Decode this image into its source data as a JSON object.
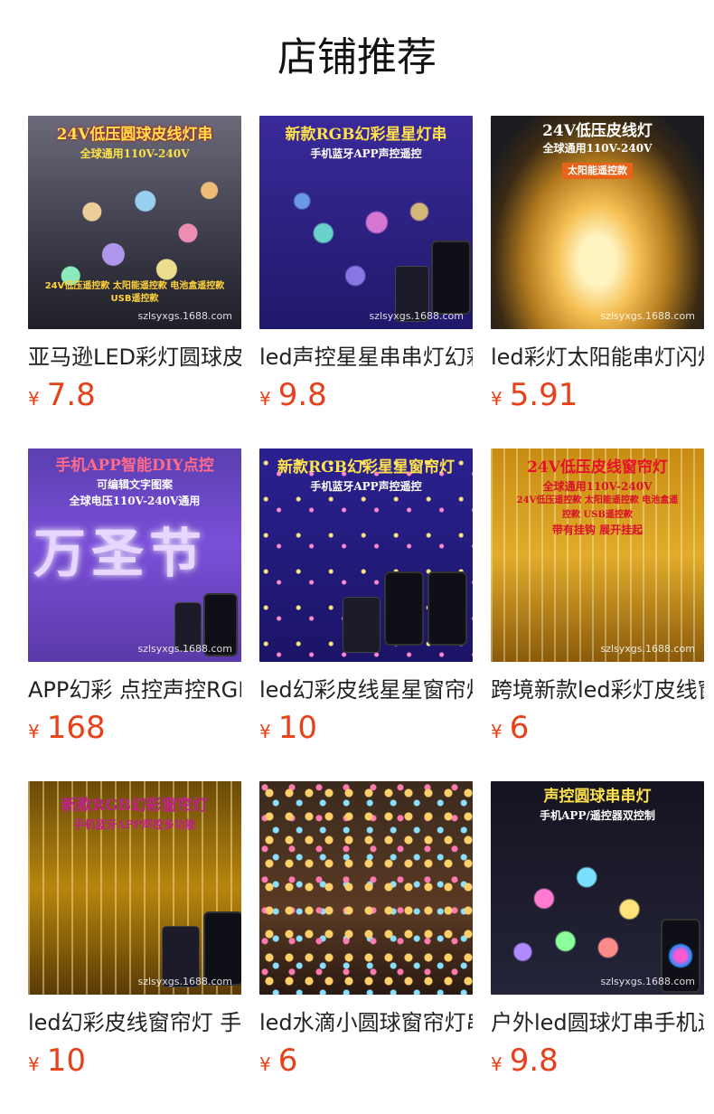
{
  "page": {
    "title": "店铺推荐"
  },
  "products": [
    {
      "name": "亚马逊LED彩灯圆球皮线灯串",
      "price": "7.8",
      "currency": "¥",
      "image": {
        "caption": "24V低压圆球皮线灯串",
        "subcaption": "全球通用110V-240V",
        "footer": "24V低压遥控款 太阳能遥控款 电池盒遥控款 USB遥控款",
        "watermark": "szlsyxgs.1688.com"
      }
    },
    {
      "name": "led声控星星串串灯幻彩",
      "price": "9.8",
      "currency": "¥",
      "image": {
        "caption": "新款RGB幻彩星星灯串",
        "subcaption": "手机蓝牙APP声控遥控",
        "watermark": "szlsyxgs.1688.com"
      }
    },
    {
      "name": "led彩灯太阳能串灯闪灯",
      "price": "5.91",
      "currency": "¥",
      "image": {
        "caption": "24V低压皮线灯",
        "subcaption": "全球通用110V-240V",
        "badge": "太阳能遥控款",
        "watermark": "szlsyxgs.1688.com"
      }
    },
    {
      "name": "APP幻彩 点控声控RGB",
      "price": "168",
      "currency": "¥",
      "image": {
        "caption": "手机APP智能DIY点控",
        "subcaption": "可编辑文字图案",
        "subcaption2": "全球电压110V-240V通用",
        "bigtext": "万圣节",
        "watermark": "szlsyxgs.1688.com"
      }
    },
    {
      "name": "led幻彩皮线星星窗帘灯",
      "price": "10",
      "currency": "¥",
      "image": {
        "caption": "新款RGB幻彩星星窗帘灯",
        "subcaption": "手机蓝牙APP声控遥控"
      }
    },
    {
      "name": "跨境新款led彩灯皮线窗帘",
      "price": "6",
      "currency": "¥",
      "image": {
        "caption": "24V低压皮线窗帘灯",
        "subcaption": "全球通用110V-240V",
        "subcaption2": "24V低压遥控款 太阳能遥控款 电池盒遥控款 USB遥控款",
        "subcaption3": "带有挂钩 展开挂起",
        "watermark": "szlsyxgs.1688.com"
      }
    },
    {
      "name": "led幻彩皮线窗帘灯 手机",
      "price": "10",
      "currency": "¥",
      "image": {
        "caption": "新款RGB幻彩窗帘灯",
        "subcaption": "手机蓝牙APP声控多功能",
        "watermark": "szlsyxgs.1688.com"
      }
    },
    {
      "name": "led水滴小圆球窗帘灯串",
      "price": "6",
      "currency": "¥",
      "image": {}
    },
    {
      "name": "户外led圆球灯串手机遥控",
      "price": "9.8",
      "currency": "¥",
      "image": {
        "caption": "声控圆球串串灯",
        "subcaption": "手机APP/遥控器双控制",
        "watermark": "szlsyxgs.1688.com"
      }
    }
  ],
  "colors": {
    "price": "#e8401a",
    "text": "#222222"
  }
}
